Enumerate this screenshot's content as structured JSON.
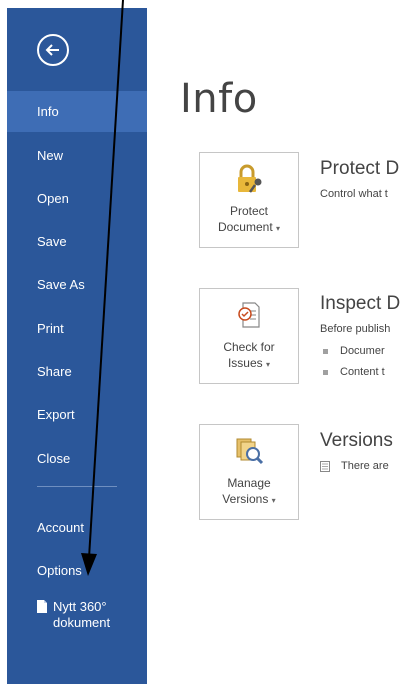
{
  "sidebar": {
    "background": "#2b579a",
    "active_background": "#3e6db5",
    "back_icon": "back-arrow-icon",
    "items": [
      {
        "label": "Info",
        "active": true
      },
      {
        "label": "New"
      },
      {
        "label": "Open"
      },
      {
        "label": "Save"
      },
      {
        "label": "Save As"
      },
      {
        "label": "Print"
      },
      {
        "label": "Share"
      },
      {
        "label": "Export"
      },
      {
        "label": "Close"
      }
    ],
    "bottom_items": [
      {
        "label": "Account"
      },
      {
        "label": "Options"
      }
    ],
    "recent_doc": {
      "icon": "document-icon",
      "label_line1": "Nytt 360°",
      "label_line2": "dokument"
    }
  },
  "main": {
    "title": "Info",
    "sections": [
      {
        "tile_label_line1": "Protect",
        "tile_label_line2": "Document",
        "tile_icon": "lock-key-icon",
        "heading": "Protect D",
        "description": "Control what t"
      },
      {
        "tile_label_line1": "Check for",
        "tile_label_line2": "Issues",
        "tile_icon": "inspect-document-icon",
        "heading": "Inspect D",
        "description": "Before publish",
        "bullets": [
          "Documer",
          "Content t"
        ]
      },
      {
        "tile_label_line1": "Manage",
        "tile_label_line2": "Versions",
        "tile_icon": "versions-magnifier-icon",
        "heading": "Versions",
        "description": "There are"
      }
    ]
  },
  "annotation": {
    "arrow_color": "#000000",
    "arrow_icon": "annotation-arrow"
  }
}
